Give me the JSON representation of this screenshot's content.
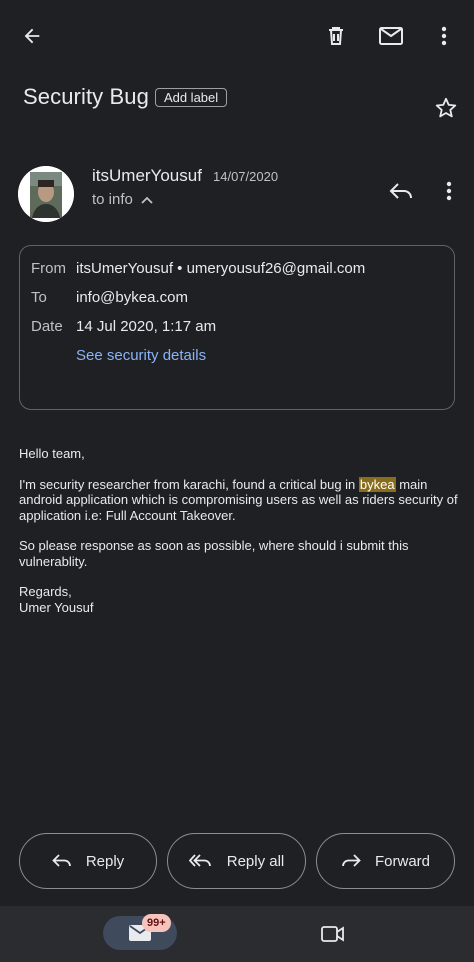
{
  "toolbar": {
    "back_icon": "arrow-back-icon",
    "delete_icon": "trash-icon",
    "mark_unread_icon": "mail-icon",
    "more_icon": "more-vert-icon"
  },
  "email": {
    "subject": "Security Bug",
    "add_label": "Add label",
    "sender_name": "itsUmerYousuf",
    "date_short": "14/07/2020",
    "to_line": "to info",
    "details": {
      "from_key": "From",
      "from_value": "itsUmerYousuf • umeryousuf26@gmail.com",
      "to_key": "To",
      "to_value": "info@bykea.com",
      "date_key": "Date",
      "date_value": "14 Jul 2020, 1:17 am",
      "security_link": "See security details"
    },
    "body": {
      "greeting": "Hello team,",
      "p1_before": "I'm security researcher from karachi, found a critical bug in ",
      "p1_highlight": "bykea",
      "p1_after": " main android application which is compromising users as well as riders security of application i.e: Full Account Takeover.",
      "p2": "So please response as soon as possible, where should i submit this vulnerablity.",
      "closing": "Regards,",
      "signature": "Umer Yousuf"
    }
  },
  "actions": {
    "reply": "Reply",
    "reply_all": "Reply all",
    "forward": "Forward"
  },
  "bottom_nav": {
    "mail_badge": "99+"
  },
  "colors": {
    "background": "#1f2023",
    "link": "#8ab4f8",
    "highlight": "#8a6d1c",
    "badge": "#f7c3bd"
  }
}
